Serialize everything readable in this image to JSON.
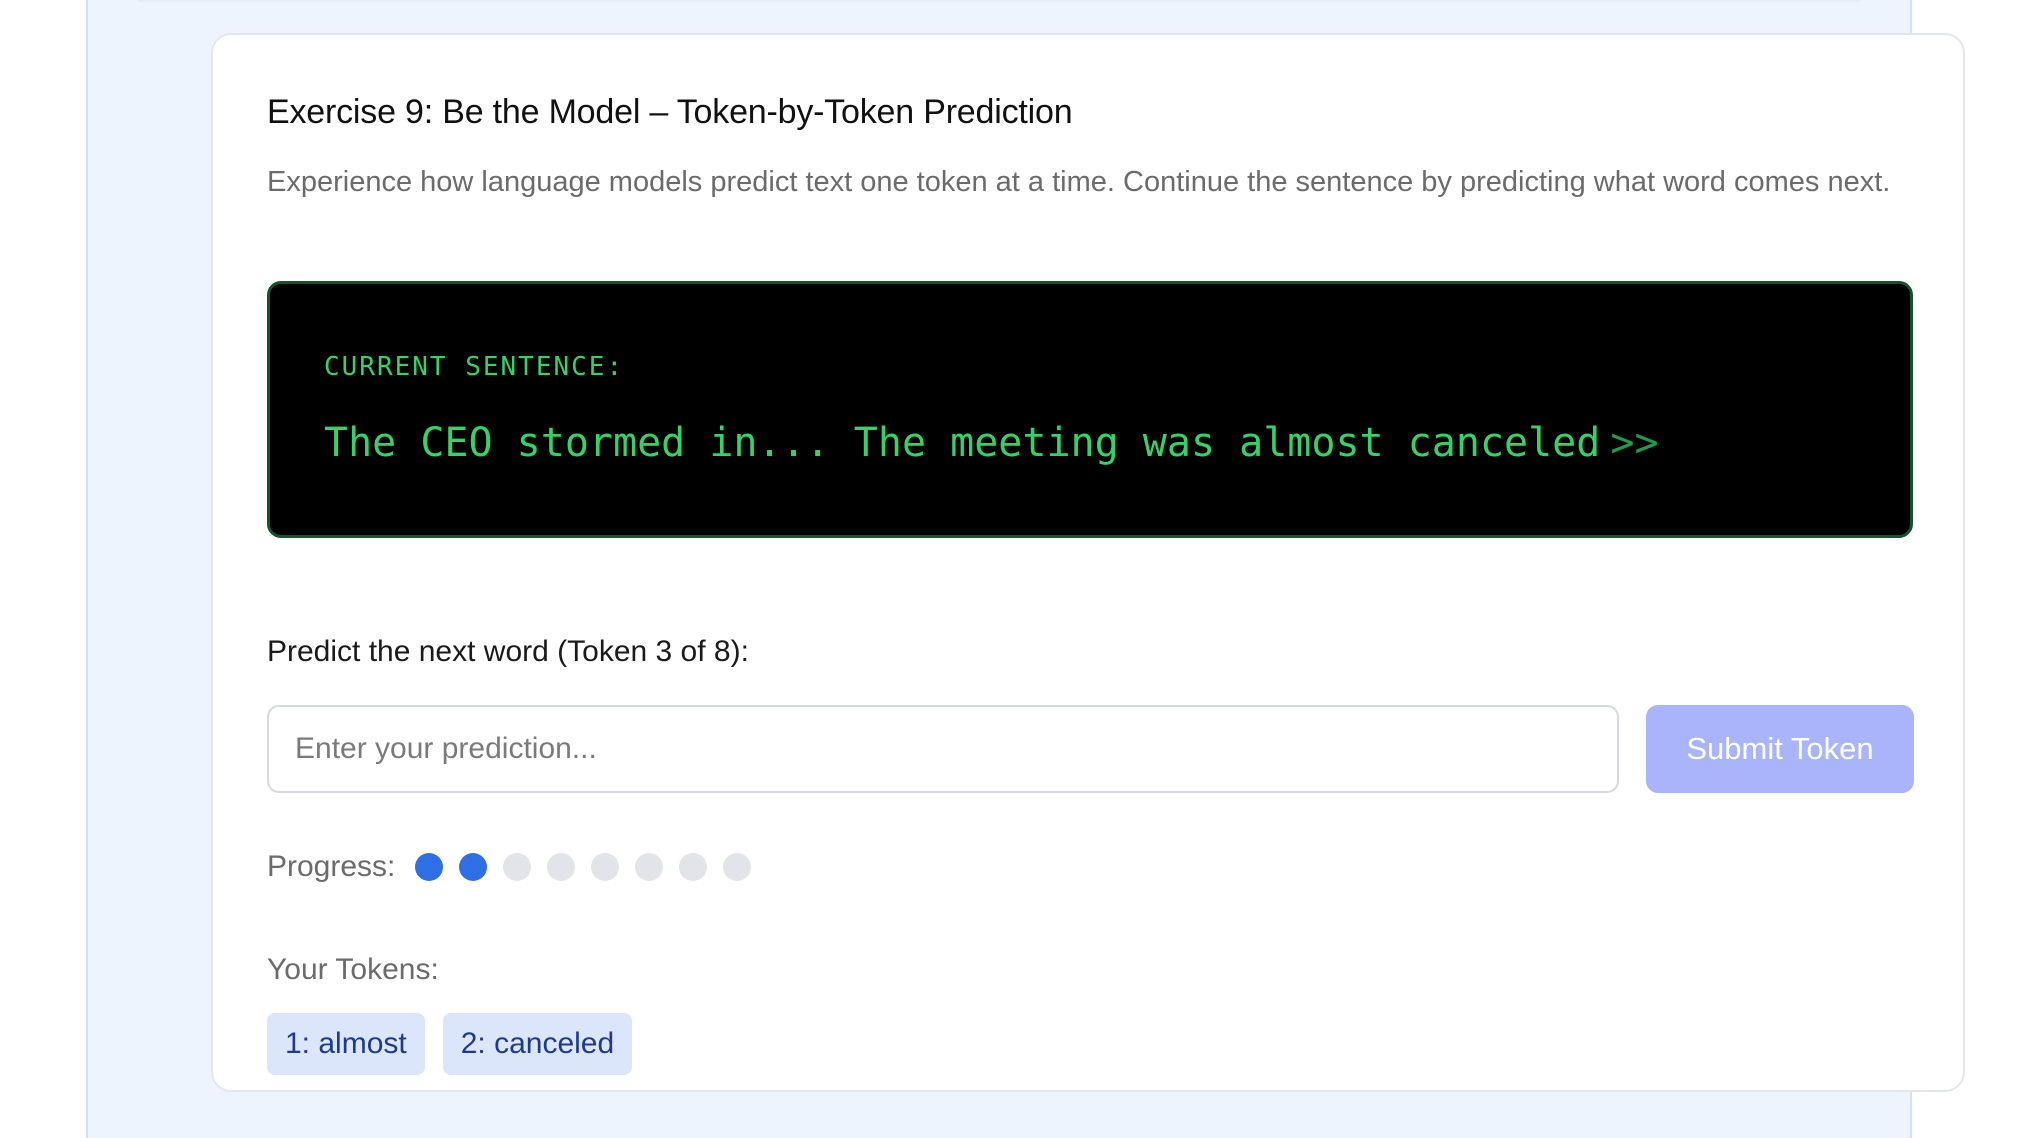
{
  "exercise": {
    "title": "Exercise 9: Be the Model – Token-by-Token Prediction",
    "description": "Experience how language models predict text one token at a time. Continue the sentence by predicting what word comes next."
  },
  "terminal": {
    "label": "CURRENT SENTENCE:",
    "sentence": "The CEO stormed in... The meeting was almost canceled",
    "cursor": ">>"
  },
  "prediction": {
    "label": "Predict the next word (Token 3 of 8):",
    "input_value": "",
    "input_placeholder": "Enter your prediction...",
    "submit_label": "Submit Token"
  },
  "progress": {
    "label": "Progress:",
    "completed": 2,
    "total": 8,
    "filled_color": "#2f6fe6",
    "empty_color": "#e2e4e9"
  },
  "tokens": {
    "label": "Your Tokens:",
    "items": [
      "1: almost",
      "2: canceled"
    ]
  }
}
